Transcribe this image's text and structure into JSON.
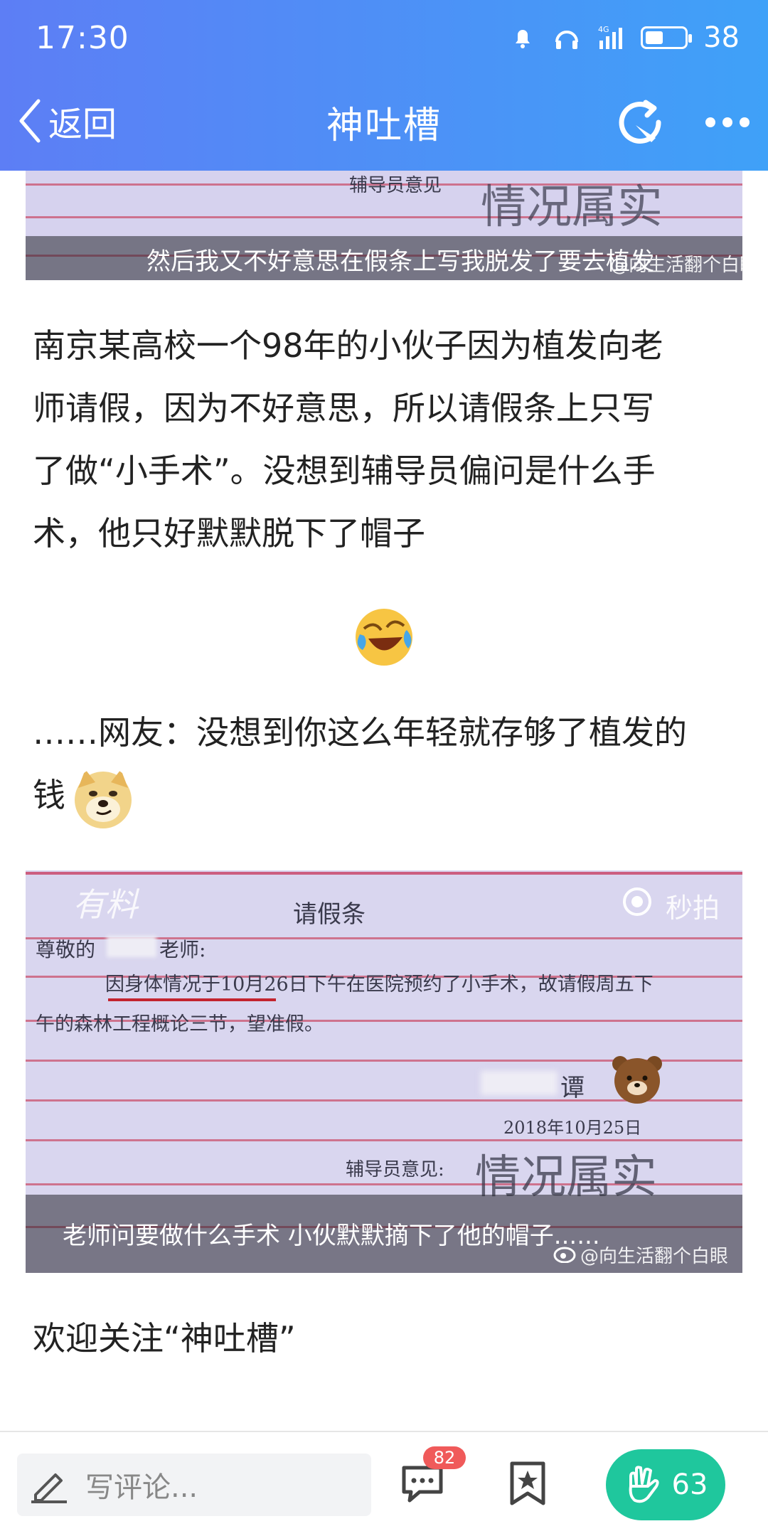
{
  "status_bar": {
    "time": "17:30",
    "battery_level": "38",
    "signal_label": "4G"
  },
  "nav": {
    "back_label": "返回",
    "title": "神吐槽"
  },
  "top_image": {
    "caption": "然后我又不好意思在假条上写我脱发了要去植发",
    "watermark": "@向生活翻个白眼",
    "handwriting": "情况属实",
    "field_label": "辅导员意见"
  },
  "paragraphs": {
    "p1_lines": [
      "南京某高校一个98年的小伙子因为植发向老",
      "师请假，因为不好意思，所以请假条上只写",
      "了做“小手术”。没想到辅导员偏问是什么手",
      "术，他只好默默脱下了帽子"
    ],
    "p2_line1": "……网友：没想到你这么年轻就存够了植发的",
    "p2_line2": "钱",
    "p3": "欢迎关注“神吐槽”"
  },
  "main_image": {
    "logo": "有料",
    "camera_brand": "秒拍",
    "note_title": "请假条",
    "salutation": "尊敬的",
    "teacher_suffix": "老师:",
    "line1": "因身体情况于10月26日下午在医院预约了小手术，故请假周五下",
    "line2": "午的森林工程概论三节，望准假。",
    "signature_char": "谭",
    "date": "2018年10月25日",
    "counselor_label": "辅导员意见:",
    "counselor_handwriting": "情况属实",
    "caption": "老师问要做什么手术 小伙默默摘下了他的帽子......",
    "watermark": "@向生活翻个白眼"
  },
  "bottom_bar": {
    "comment_placeholder": "写评论...",
    "comment_count": "82",
    "like_count": "63"
  },
  "colors": {
    "header_start": "#5d7ef5",
    "header_end": "#3fa1f8",
    "like_button": "#1fc79d",
    "badge": "#f05a5a"
  }
}
